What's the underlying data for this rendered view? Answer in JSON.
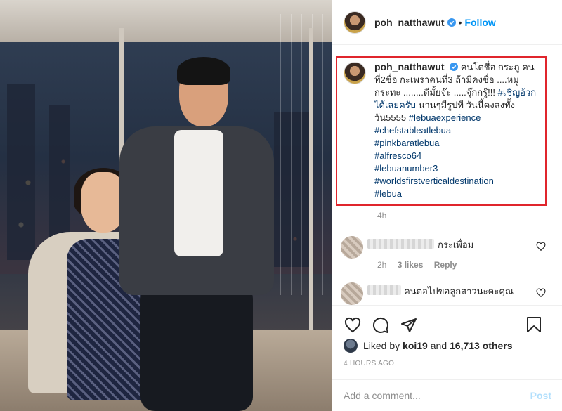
{
  "post": {
    "username": "poh_natthawut",
    "follow_label": "Follow",
    "dot": "•",
    "caption": {
      "username": "poh_natthawut",
      "text": "คนโตชื่อ กระภู คนที่2ชื่อ กะเพราคนที่3 ถ้ามีคงชื่อ ....หมูกระทะ ........ดีมั้ยจ๊ะ .....จุ๊กกรู๊!!! ",
      "inline_tag": "#เชิญอ้วกได้เลยครับ",
      "text2": " นานๆมีรูปที วันนี้คงลงทั้งวัน5555 ",
      "inline_tag2": "#lebuaexperience",
      "tags": [
        "#chefstableatlebua",
        "#pinkbaratlebua",
        "#alfresco64",
        "#lebuanumber3",
        "#worldsfirstverticaldestination",
        "#lebua"
      ],
      "time": "4h"
    },
    "comments": [
      {
        "text": "กระเพื่อม",
        "time": "2h",
        "likes": "3 likes",
        "reply": "Reply"
      },
      {
        "text": "คนต่อไปขอลูกสาวนะคะคุณ"
      }
    ],
    "liked_by": {
      "prefix": "Liked by ",
      "user": "koi19",
      "middle": " and ",
      "others": "16,713 others"
    },
    "posted_ago": "4 HOURS AGO",
    "add_comment_placeholder": "Add a comment...",
    "post_label": "Post"
  },
  "colors": {
    "link": "#0095f6",
    "hashtag": "#00376b",
    "highlight_box": "#e0252c"
  },
  "icons": {
    "verified": "verified-badge-icon",
    "like": "heart-icon",
    "comment": "comment-icon",
    "share": "share-icon",
    "save": "bookmark-icon"
  }
}
